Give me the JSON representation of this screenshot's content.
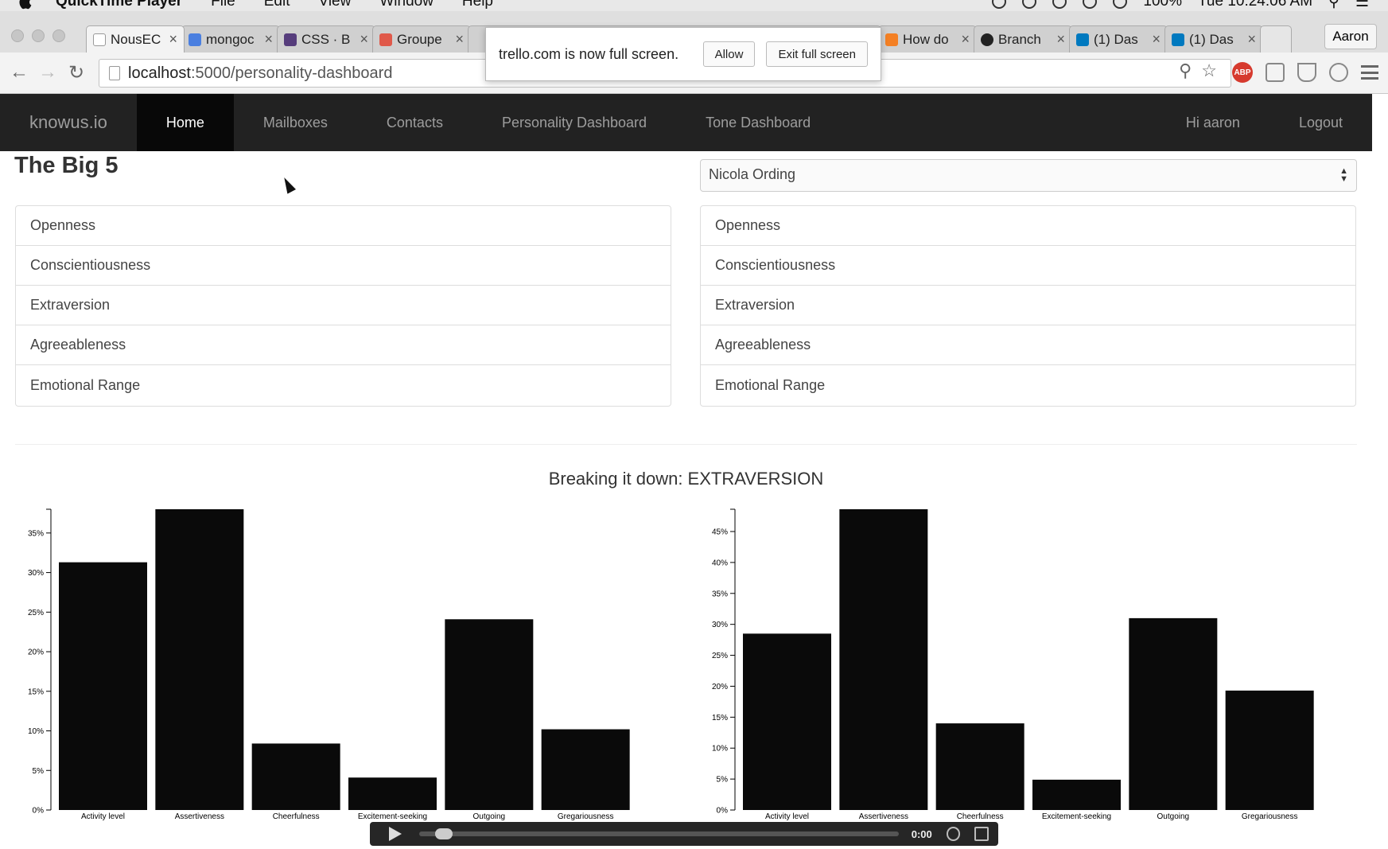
{
  "menubar": {
    "app_name": "QuickTime Player",
    "menus": [
      "File",
      "Edit",
      "View",
      "Window",
      "Help"
    ],
    "battery": "100%",
    "clock": "Tue 10:24:06 AM"
  },
  "browser": {
    "tabs": [
      {
        "title": "NousEC",
        "color": "#ffffff"
      },
      {
        "title": "mongoc",
        "color": "#4a7fe0"
      },
      {
        "title": "CSS · B",
        "color": "#563d7c"
      },
      {
        "title": "Groupe",
        "color": "#e0594a"
      },
      {
        "title": "How do",
        "color": "#f48024"
      },
      {
        "title": "Branch",
        "color": "#222222"
      },
      {
        "title": "(1) Das",
        "color": "#0079bf"
      },
      {
        "title": "(1) Das",
        "color": "#0079bf"
      }
    ],
    "profile_name": "Aaron",
    "url_host": "localhost",
    "url_path": ":5000/personality-dashboard",
    "abp_label": "ABP"
  },
  "fullscreen_popup": {
    "message": "trello.com is now full screen.",
    "allow_label": "Allow",
    "exit_label": "Exit full screen"
  },
  "navbar": {
    "brand": "knowus.io",
    "links": [
      "Home",
      "Mailboxes",
      "Contacts",
      "Personality Dashboard",
      "Tone Dashboard"
    ],
    "greeting": "Hi aaron",
    "logout": "Logout"
  },
  "dashboard": {
    "title": "The Big 5",
    "selected_person": "Nicola Ording",
    "traits_left": [
      "Openness",
      "Conscientiousness",
      "Extraversion",
      "Agreeableness",
      "Emotional Range"
    ],
    "traits_right": [
      "Openness",
      "Conscientiousness",
      "Extraversion",
      "Agreeableness",
      "Emotional Range"
    ],
    "breakdown_title": "Breaking it down: EXTRAVERSION"
  },
  "chart_data": [
    {
      "type": "bar",
      "categories": [
        "Activity level",
        "Assertiveness",
        "Cheerfulness",
        "Excitement-seeking",
        "Outgoing",
        "Gregariousness"
      ],
      "values": [
        31.3,
        38,
        8.4,
        4.1,
        24.1,
        10.2
      ],
      "yticks": [
        "0%",
        "5%",
        "10%",
        "15%",
        "20%",
        "25%",
        "30%",
        "35%"
      ],
      "ylim": [
        0,
        38
      ],
      "bar_color": "#0a0a0a"
    },
    {
      "type": "bar",
      "categories": [
        "Activity level",
        "Assertiveness",
        "Cheerfulness",
        "Excitement-seeking",
        "Outgoing",
        "Gregariousness"
      ],
      "values": [
        28.5,
        48.6,
        14,
        4.9,
        31,
        19.3
      ],
      "yticks": [
        "0%",
        "5%",
        "10%",
        "15%",
        "20%",
        "25%",
        "30%",
        "35%",
        "40%",
        "45%"
      ],
      "ylim": [
        0,
        48.6
      ],
      "bar_color": "#0a0a0a"
    }
  ],
  "player": {
    "time": "0:00"
  }
}
